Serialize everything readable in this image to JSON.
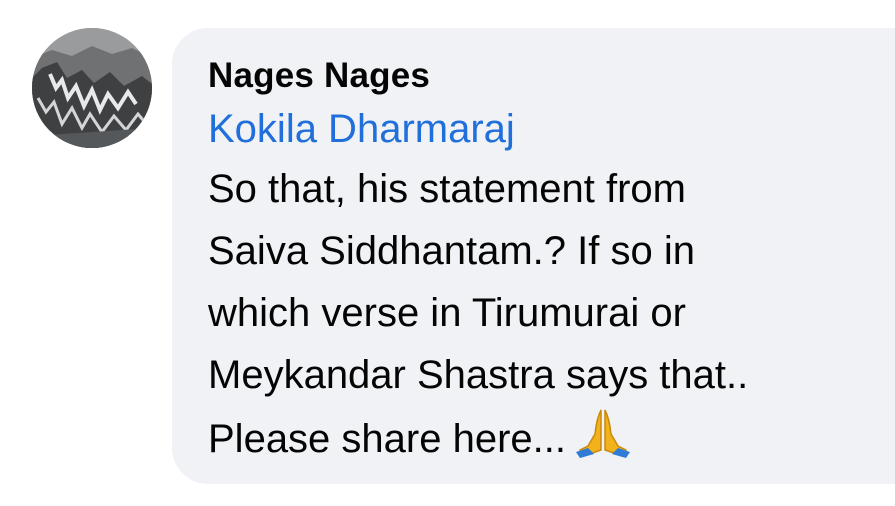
{
  "comment": {
    "avatar_icon": "mountain-photo-avatar",
    "author": "Nages Nages",
    "mention": "Kokila Dharmaraj",
    "lines": [
      "So that, his statement from",
      "Saiva Siddhantam.? If so in",
      "which verse in Tirumurai or",
      "Meykandar Shastra says that..",
      "Please share here..."
    ],
    "emoji_icon": "folded-hands-emoji",
    "colors": {
      "bubble": "#f0f2f5",
      "mention": "#216fdb",
      "text": "#050505",
      "emoji": "#f2b21b"
    }
  }
}
